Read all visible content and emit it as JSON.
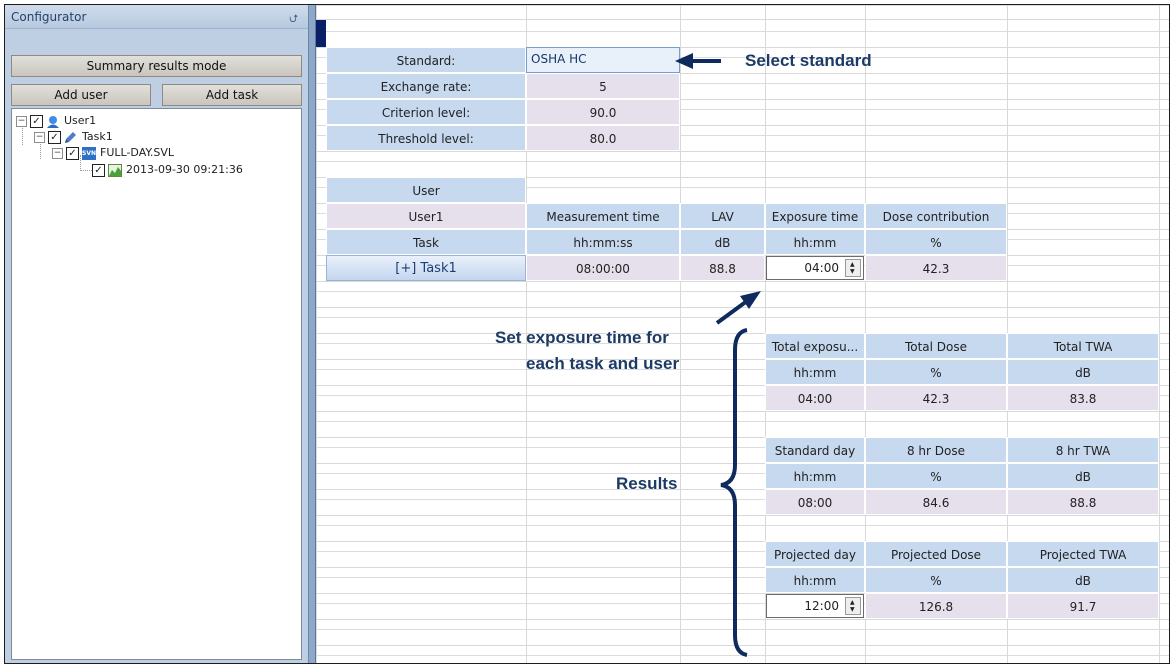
{
  "panel": {
    "title": "Configurator",
    "pin_icon": "pin-icon",
    "summary_button": "Summary results mode",
    "add_user_button": "Add user",
    "add_task_button": "Add task",
    "tree": {
      "user": "User1",
      "task": "Task1",
      "file": "FULL-DAY.SVL",
      "file_icon_text": "SVN",
      "measurement": "2013-09-30 09:21:36"
    }
  },
  "settings": {
    "standard_label": "Standard:",
    "standard_value": "OSHA HC",
    "exchange_label": "Exchange rate:",
    "exchange_value": "5",
    "criterion_label": "Criterion level:",
    "criterion_value": "90.0",
    "threshold_label": "Threshold level:",
    "threshold_value": "80.0"
  },
  "user_table": {
    "user_header": "User",
    "user_name": "User1",
    "task_header": "Task",
    "col_meas": "Measurement time",
    "col_lav": "LAV",
    "col_exposure": "Exposure time",
    "col_dose": "Dose contribution",
    "unit_meas": "hh:mm:ss",
    "unit_lav": "dB",
    "unit_exposure": "hh:mm",
    "unit_dose": "%",
    "task_button": "[+] Task1",
    "meas_value": "08:00:00",
    "lav_value": "88.8",
    "exposure_value": "04:00",
    "dose_value": "42.3"
  },
  "results": {
    "total": {
      "c1": "Total exposu...",
      "c2": "Total Dose",
      "c3": "Total TWA",
      "u1": "hh:mm",
      "u2": "%",
      "u3": "dB",
      "v1": "04:00",
      "v2": "42.3",
      "v3": "83.8"
    },
    "standard": {
      "c1": "Standard day",
      "c2": "8 hr Dose",
      "c3": "8 hr TWA",
      "u1": "hh:mm",
      "u2": "%",
      "u3": "dB",
      "v1": "08:00",
      "v2": "84.6",
      "v3": "88.8"
    },
    "projected": {
      "c1": "Projected day",
      "c2": "Projected Dose",
      "c3": "Projected TWA",
      "u1": "hh:mm",
      "u2": "%",
      "u3": "dB",
      "v1": "12:00",
      "v2": "126.8",
      "v3": "91.7"
    }
  },
  "annotations": {
    "select_standard": "Select standard",
    "set_exposure_line1": "Set exposure time for",
    "set_exposure_line2": "each task and user",
    "results": "Results"
  },
  "colors": {
    "header_blue": "#c7d9ef",
    "value_lilac": "#e5e0ec",
    "annotation_navy": "#1c3a66"
  }
}
